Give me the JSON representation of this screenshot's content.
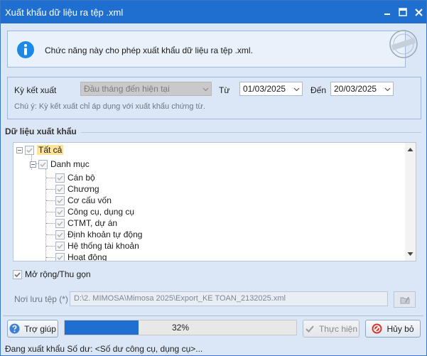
{
  "window": {
    "title": "Xuất khẩu dữ liệu ra tệp .xml"
  },
  "info": {
    "text": "Chức năng này cho phép xuất khẩu dữ liệu ra tệp .xml.",
    "stamp_text": "ĐỦ KẾ THỂ HIỆN"
  },
  "period": {
    "label": "Kỳ kết xuất",
    "preset": "Đầu tháng đến hiện tại",
    "from_label": "Từ",
    "from_value": "01/03/2025",
    "to_label": "Đến",
    "to_value": "20/03/2025",
    "note": "Chú ý: Kỳ kết xuất chỉ áp dụng với xuất khẩu chứng từ."
  },
  "export_group": {
    "title": "Dữ liệu xuất khẩu",
    "tree": {
      "root": "Tất cả",
      "category": "Danh mục",
      "items": [
        "Cán bộ",
        "Chương",
        "Cơ cấu vốn",
        "Công cụ, dụng cụ",
        "CTMT, dự án",
        "Định khoản tự động",
        "Hệ thống tài khoản",
        "Hoạt động"
      ]
    }
  },
  "expand_toggle": {
    "label": "Mở rộng/Thu gọn",
    "checked": true
  },
  "save_path": {
    "label": "Nơi lưu tệp (*)",
    "value": "D:\\2. MIMOSA\\Mimosa 2025\\Export_KE TOAN_2132025.xml"
  },
  "footer": {
    "help_label": "Trợ giúp",
    "progress_percent": 32,
    "progress_text": "32%",
    "execute_label": "Thực hiện",
    "cancel_label": "Hủy bỏ",
    "status": "Đang xuất khẩu Số dư: <Số dư công cụ, dụng cụ>..."
  },
  "colors": {
    "titlebar": "#1f6fd1",
    "panel": "#dbe7f6",
    "progress": "#1f6fd1",
    "selected": "#fde39a"
  }
}
